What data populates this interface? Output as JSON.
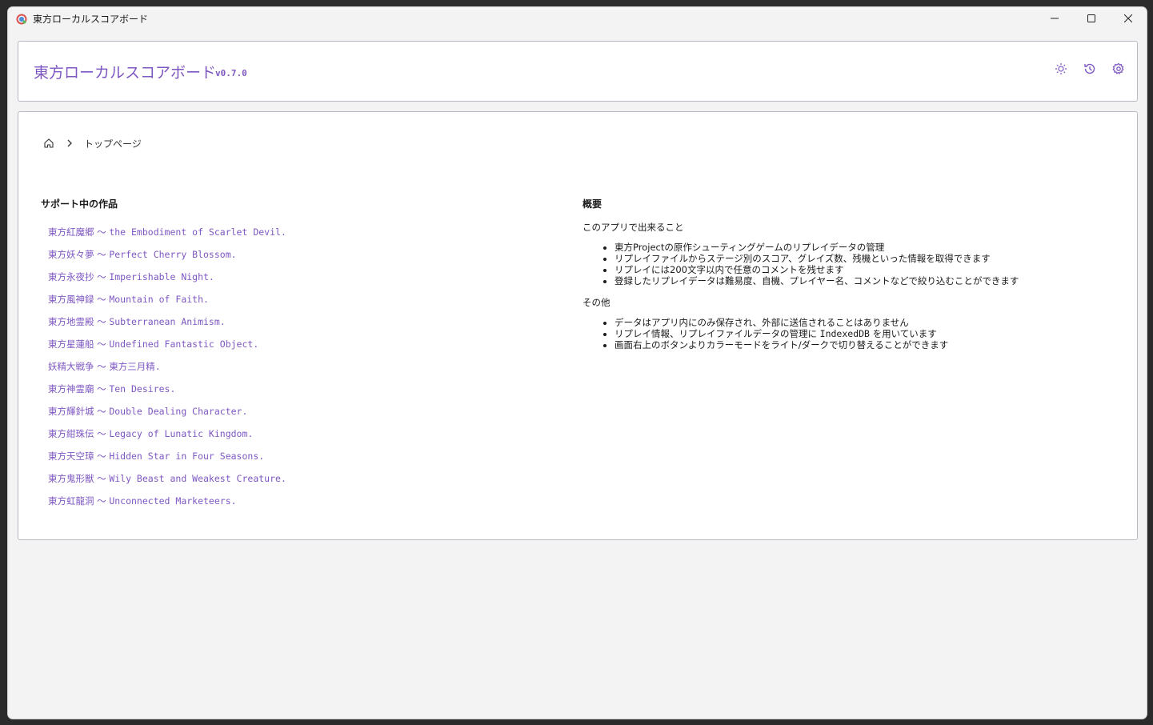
{
  "window": {
    "title": "東方ローカルスコアボード"
  },
  "header": {
    "app_title": "東方ローカルスコアボード",
    "version": "v0.7.0",
    "buttons": [
      "sun-icon",
      "history-icon",
      "gear-icon"
    ]
  },
  "breadcrumb": {
    "current": "トップページ"
  },
  "supported": {
    "title": "サポート中の作品",
    "games": [
      {
        "ja": "東方紅魔郷",
        "en": "the Embodiment of Scarlet Devil."
      },
      {
        "ja": "東方妖々夢",
        "en": "Perfect Cherry Blossom."
      },
      {
        "ja": "東方永夜抄",
        "en": "Imperishable Night."
      },
      {
        "ja": "東方風神録",
        "en": "Mountain of Faith."
      },
      {
        "ja": "東方地霊殿",
        "en": "Subterranean Animism."
      },
      {
        "ja": "東方星蓮船",
        "en": "Undefined Fantastic Object."
      },
      {
        "ja": "妖精大戦争",
        "en": "東方三月精."
      },
      {
        "ja": "東方神霊廟",
        "en": "Ten Desires."
      },
      {
        "ja": "東方輝針城",
        "en": "Double Dealing Character."
      },
      {
        "ja": "東方紺珠伝",
        "en": "Legacy of Lunatic Kingdom."
      },
      {
        "ja": "東方天空璋",
        "en": "Hidden Star in Four Seasons."
      },
      {
        "ja": "東方鬼形獣",
        "en": "Wily Beast and Weakest Creature."
      },
      {
        "ja": "東方虹龍洞",
        "en": "Unconnected Marketeers."
      }
    ],
    "separator": "～"
  },
  "overview": {
    "title": "概要",
    "features_heading": "このアプリで出来ること",
    "features": [
      "東方Projectの原作シューティングゲームのリプレイデータの管理",
      "リプレイファイルからステージ別のスコア、グレイズ数、残機といった情報を取得できます",
      "リプレイには200文字以内で任意のコメントを残せます",
      "登録したリプレイデータは難易度、自機、プレイヤー名、コメントなどで絞り込むことができます"
    ],
    "other_heading": "その他",
    "other": [
      "データはアプリ内にのみ保存され、外部に送信されることはありません",
      {
        "before": "リプレイ情報、リプレイファイルデータの管理に ",
        "code": "IndexedDB",
        "after": " を用いています"
      },
      "画面右上のボタンよりカラーモードをライト/ダークで切り替えることができます"
    ]
  },
  "colors": {
    "accent": "#7e57c2"
  }
}
